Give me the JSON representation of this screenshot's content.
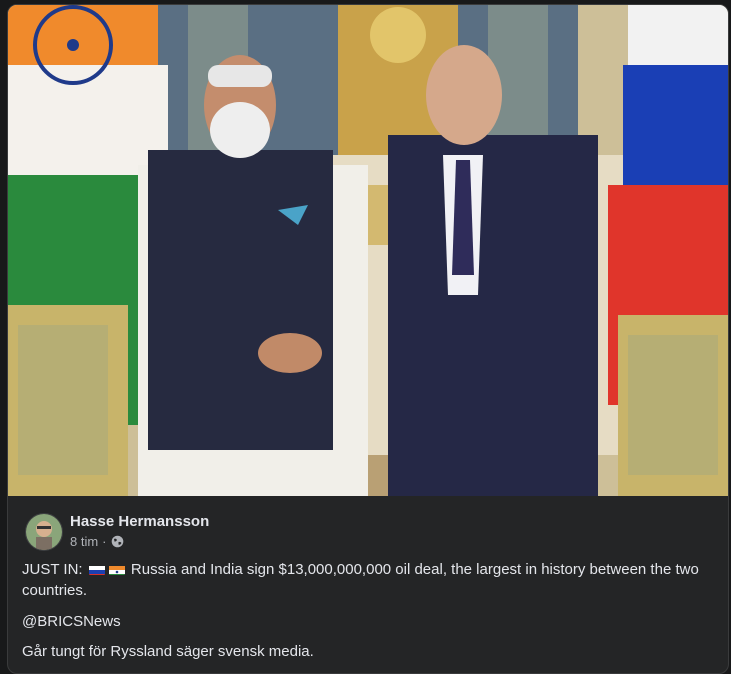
{
  "post": {
    "author": "Hasse Hermansson",
    "time": "8 tim",
    "separator": "·",
    "privacy_icon": "globe-icon",
    "text_prefix": "JUST IN:",
    "flags": [
      "russia-flag-icon",
      "india-flag-icon"
    ],
    "text_main": "Russia and India sign $13,000,000,000 oil deal, the largest in history between the two countries.",
    "mention": "@BRICSNews",
    "comment": "Går tungt för Ryssland säger svensk media."
  },
  "colors": {
    "background": "#18191a",
    "card": "#242526",
    "text_primary": "#e4e6eb",
    "text_secondary": "#b0b3b8"
  }
}
